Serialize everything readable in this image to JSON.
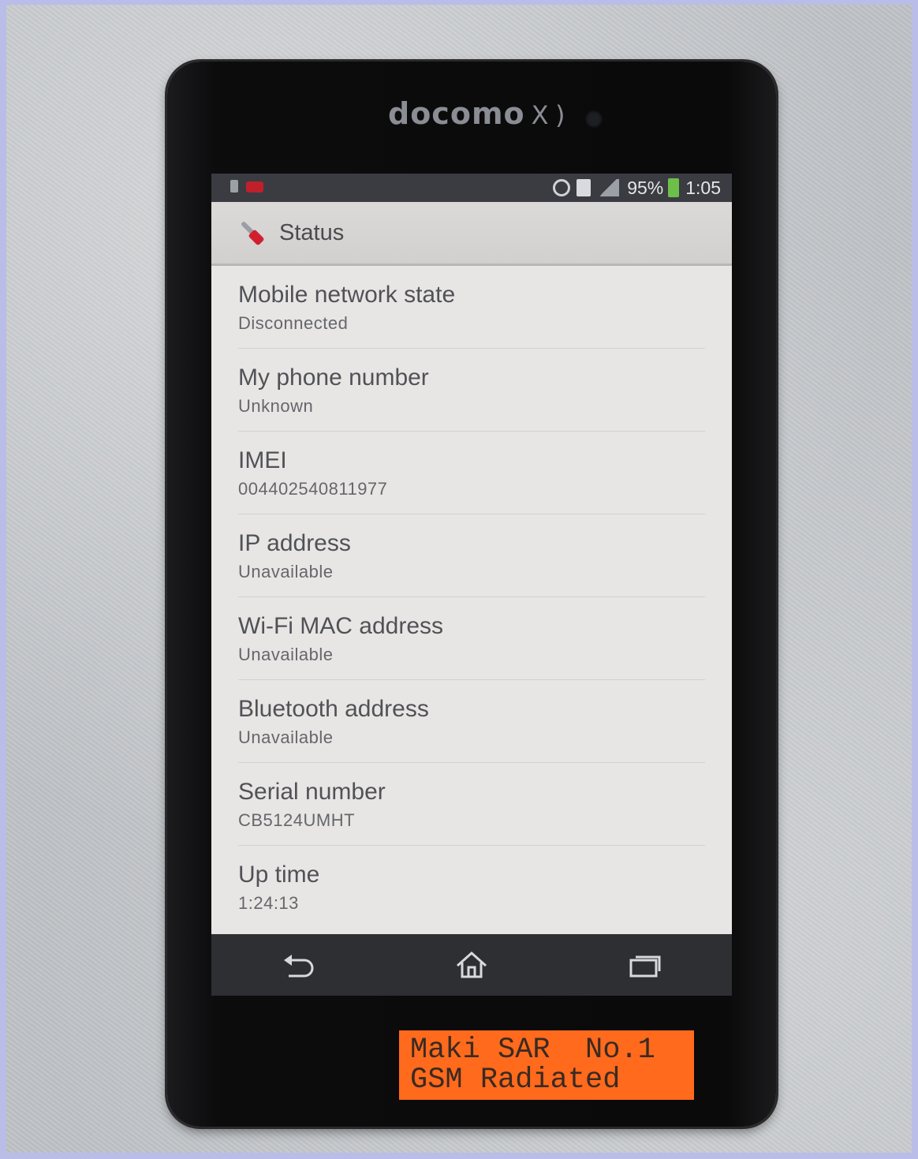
{
  "device": {
    "brand": "docomo",
    "brand_suffix": "X )",
    "label_line1": "Maki SAR  No.1",
    "label_line2": "GSM Radiated"
  },
  "statusbar": {
    "battery": "95%",
    "time": "1:05",
    "icons": [
      "sim-icon",
      "notification-icon",
      "sync-icon",
      "sd-card-icon",
      "signal-icon",
      "battery-icon"
    ]
  },
  "header": {
    "title": "Status",
    "icon": "tools-icon"
  },
  "items": [
    {
      "title": "Mobile network state",
      "value": "Disconnected"
    },
    {
      "title": "My phone number",
      "value": "Unknown"
    },
    {
      "title": "IMEI",
      "value": "004402540811977"
    },
    {
      "title": "IP address",
      "value": "Unavailable"
    },
    {
      "title": "Wi-Fi MAC address",
      "value": "Unavailable"
    },
    {
      "title": "Bluetooth address",
      "value": "Unavailable"
    },
    {
      "title": "Serial number",
      "value": "CB5124UMHT"
    },
    {
      "title": "Up time",
      "value": "1:24:13"
    }
  ],
  "navbar": {
    "buttons": [
      "back-icon",
      "home-icon",
      "recent-apps-icon"
    ]
  },
  "colors": {
    "sticker": "#ff6a1c",
    "battery": "#6cc04a",
    "accent_red": "#d02030"
  }
}
